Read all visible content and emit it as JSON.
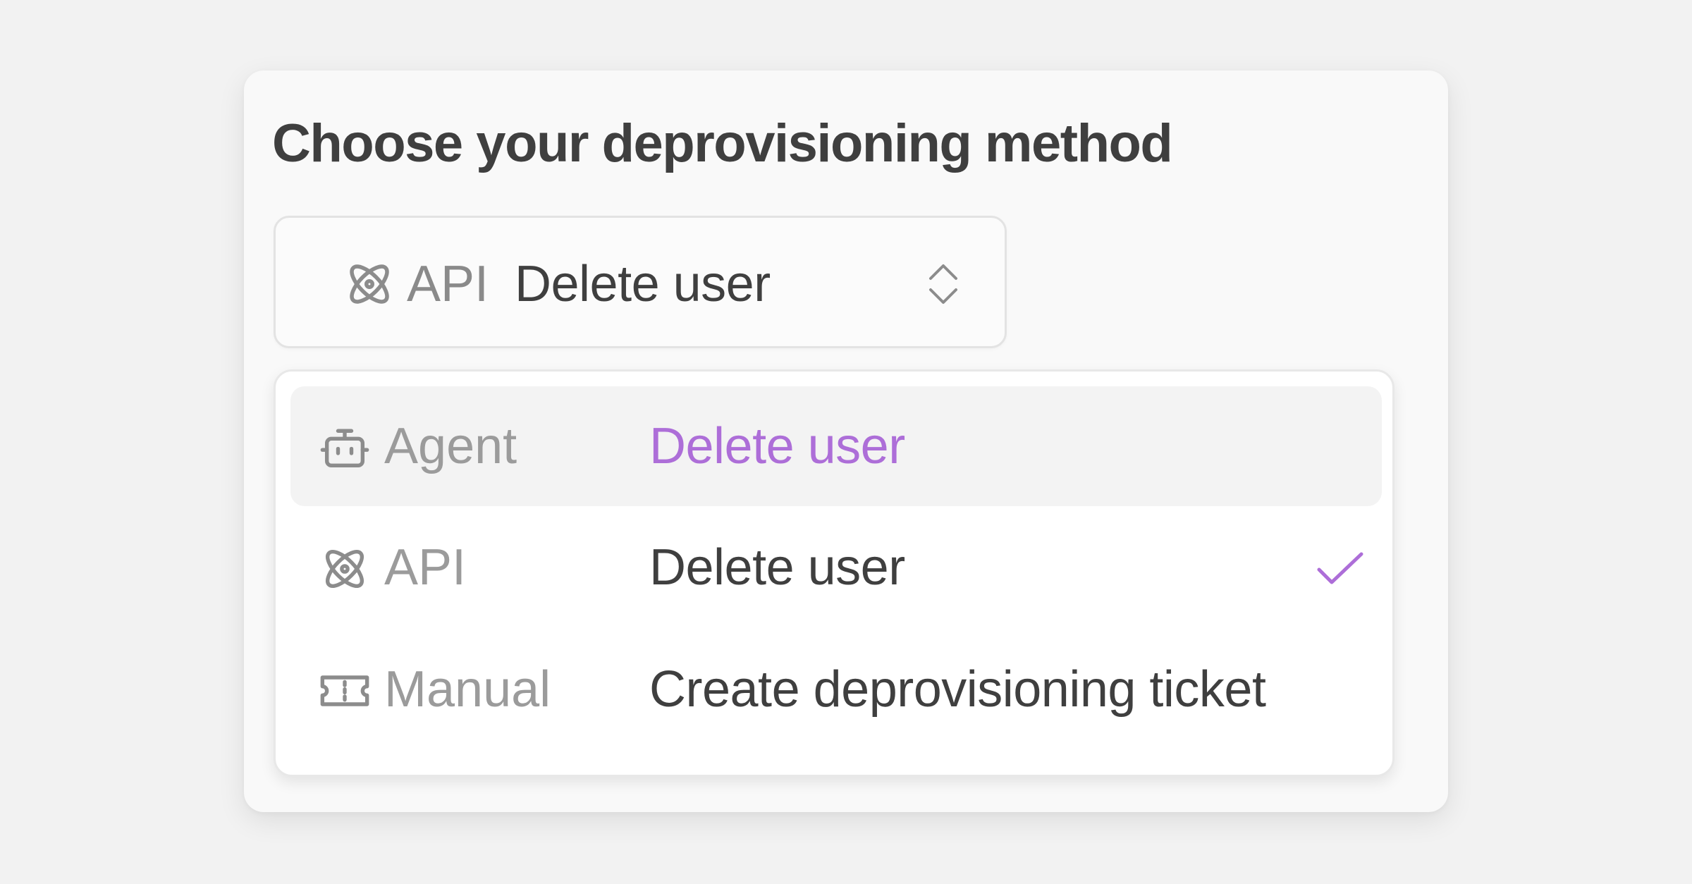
{
  "title": "Choose your deprovisioning method",
  "trigger": {
    "icon": "atom-icon",
    "method": "API",
    "action": "Delete user",
    "chevron_icon": "chevron-up-down-icon"
  },
  "options": [
    {
      "icon": "robot-icon",
      "method": "Agent",
      "action": "Delete user",
      "highlighted": true,
      "selected": false
    },
    {
      "icon": "atom-icon",
      "method": "API",
      "action": "Delete user",
      "highlighted": false,
      "selected": true
    },
    {
      "icon": "ticket-icon",
      "method": "Manual",
      "action": "Create deprovisioning ticket",
      "highlighted": false,
      "selected": false
    }
  ],
  "colors": {
    "accent": "#ad6ed8",
    "text_primary": "#3f3f3f",
    "text_secondary": "#9b9b9b",
    "icon": "#8c8c8c",
    "highlight_bg": "#f3f3f3",
    "page_bg": "#f2f2f2"
  }
}
